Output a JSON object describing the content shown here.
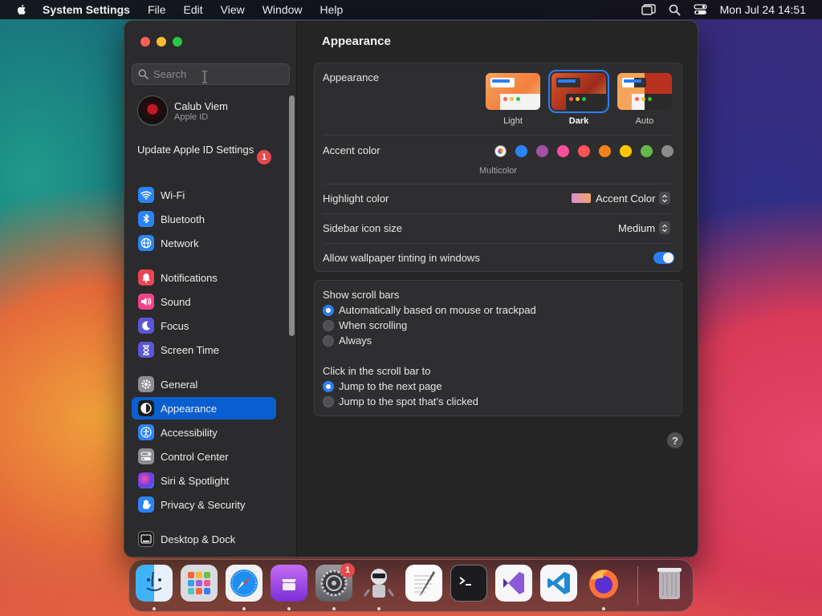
{
  "menubar": {
    "app_name": "System Settings",
    "menus": [
      "File",
      "Edit",
      "View",
      "Window",
      "Help"
    ],
    "clock": "Mon Jul 24  14:51"
  },
  "sidebar": {
    "search_placeholder": "Search",
    "profile": {
      "name": "Calub Viem",
      "subtitle": "Apple ID"
    },
    "update": {
      "label": "Update Apple ID Settings",
      "badge": "1"
    },
    "items": [
      {
        "label": "Wi-Fi",
        "icon": "wifi-icon",
        "color": "#2a84f6"
      },
      {
        "label": "Bluetooth",
        "icon": "bluetooth-icon",
        "color": "#2a84f6"
      },
      {
        "label": "Network",
        "icon": "globe-icon",
        "color": "#2a84f6"
      },
      {
        "label": "Notifications",
        "icon": "bell-icon",
        "color": "#ef4453"
      },
      {
        "label": "Sound",
        "icon": "speaker-icon",
        "color": "#ef4489"
      },
      {
        "label": "Focus",
        "icon": "moon-icon",
        "color": "#5b56d6"
      },
      {
        "label": "Screen Time",
        "icon": "hourglass-icon",
        "color": "#5b56d6"
      },
      {
        "label": "General",
        "icon": "gear-icon",
        "color": "#8e8e93"
      },
      {
        "label": "Appearance",
        "icon": "appearance-icon",
        "color": "#1c1c1e"
      },
      {
        "label": "Accessibility",
        "icon": "accessibility-icon",
        "color": "#2a84f6"
      },
      {
        "label": "Control Center",
        "icon": "control-center-icon",
        "color": "#8e8e93"
      },
      {
        "label": "Siri & Spotlight",
        "icon": "siri-icon",
        "color": "#7b3fd8"
      },
      {
        "label": "Privacy & Security",
        "icon": "hand-icon",
        "color": "#2a84f6"
      },
      {
        "label": "Desktop & Dock",
        "icon": "dock-icon",
        "color": "#1c1c1e"
      }
    ]
  },
  "content": {
    "title": "Appearance",
    "appearance": {
      "label": "Appearance",
      "options": [
        "Light",
        "Dark",
        "Auto"
      ],
      "selected": "Dark"
    },
    "accent": {
      "label": "Accent color",
      "caption": "Multicolor",
      "colors": [
        "#8e8e93",
        "#2a84f6",
        "#a550a7",
        "#f74f9e",
        "#ff5257",
        "#f7821b",
        "#ffc600",
        "#62ba46",
        "#8c8c8c"
      ]
    },
    "highlight": {
      "label": "Highlight color",
      "value": "Accent Color"
    },
    "icon_size": {
      "label": "Sidebar icon size",
      "value": "Medium"
    },
    "tinting": {
      "label": "Allow wallpaper tinting in windows",
      "on": true
    },
    "scroll_bars": {
      "label": "Show scroll bars",
      "options": [
        "Automatically based on mouse or trackpad",
        "When scrolling",
        "Always"
      ],
      "selected_index": 0
    },
    "click_scroll": {
      "label": "Click in the scroll bar to",
      "options": [
        "Jump to the next page",
        "Jump to the spot that’s clicked"
      ],
      "selected_index": 0
    },
    "help": "?"
  },
  "dock": {
    "apps": [
      {
        "name": "finder-icon",
        "running": true
      },
      {
        "name": "launchpad-icon",
        "running": false
      },
      {
        "name": "safari-icon",
        "running": true
      },
      {
        "name": "podcasts-icon",
        "running": true
      },
      {
        "name": "system-settings-icon",
        "running": true,
        "badge": "1"
      },
      {
        "name": "automator-icon",
        "running": true
      },
      {
        "name": "textedit-icon",
        "running": false
      },
      {
        "name": "terminal-icon",
        "running": false
      },
      {
        "name": "visual-studio-icon",
        "running": false
      },
      {
        "name": "vscode-icon",
        "running": false
      },
      {
        "name": "firefox-icon",
        "running": true
      },
      {
        "name": "trash-icon",
        "running": false
      }
    ]
  }
}
